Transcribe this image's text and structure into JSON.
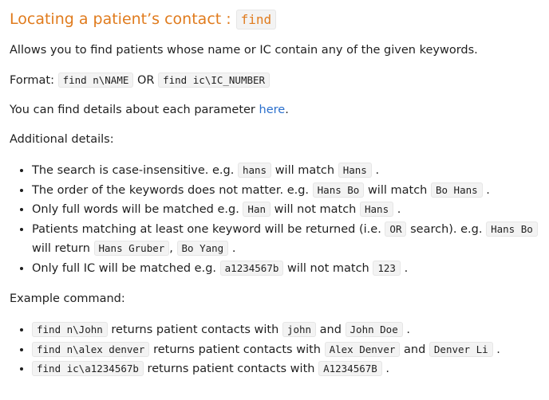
{
  "heading": {
    "text": "Locating a patient’s contact :",
    "code": "find"
  },
  "intro": "Allows you to find patients whose name or IC contain any of the given keywords.",
  "format": {
    "label": "Format:",
    "code1": "find n\\NAME",
    "or": "OR",
    "code2": "find ic\\IC_NUMBER"
  },
  "details_line": {
    "before": "You can find details about each parameter",
    "link": "here",
    "after": "."
  },
  "additional_label": "Additional details:",
  "details": {
    "d1": {
      "t1": "The search is case-insensitive. e.g.",
      "c1": "hans",
      "t2": "will match",
      "c2": "Hans",
      "t3": "."
    },
    "d2": {
      "t1": "The order of the keywords does not matter. e.g.",
      "c1": "Hans Bo",
      "t2": "will match",
      "c2": "Bo Hans",
      "t3": "."
    },
    "d3": {
      "t1": "Only full words will be matched e.g.",
      "c1": "Han",
      "t2": "will not match",
      "c2": "Hans",
      "t3": "."
    },
    "d4": {
      "t1": "Patients matching at least one keyword will be returned (i.e.",
      "c1": "OR",
      "t2": "search). e.g.",
      "c2": "Hans Bo",
      "t3": "will return",
      "c3": "Hans Gruber",
      "t4": ",",
      "c4": "Bo Yang",
      "t5": "."
    },
    "d5": {
      "t1": "Only full IC will be matched e.g.",
      "c1": "a1234567b",
      "t2": "will not match",
      "c2": "123",
      "t3": "."
    }
  },
  "example_label": "Example command:",
  "examples": {
    "e1": {
      "c1": "find n\\John",
      "t1": "returns patient contacts with",
      "c2": "john",
      "t2": "and",
      "c3": "John Doe",
      "t3": "."
    },
    "e2": {
      "c1": "find n\\alex denver",
      "t1": "returns patient contacts with",
      "c2": "Alex Denver",
      "t2": "and",
      "c3": "Denver Li",
      "t3": "."
    },
    "e3": {
      "c1": "find ic\\a1234567b",
      "t1": "returns patient contacts with",
      "c2": "A1234567B",
      "t2": "."
    }
  }
}
